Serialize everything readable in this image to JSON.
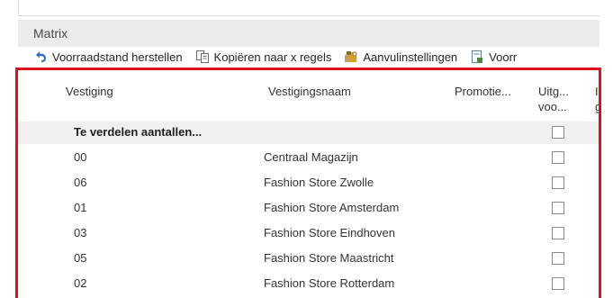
{
  "section": {
    "title": "Matrix"
  },
  "toolbar": {
    "actions": [
      {
        "label": "Voorraadstand herstellen",
        "icon": "undo-arrow-icon",
        "color": "#2f6fbf"
      },
      {
        "label": "Kopiëren naar x regels",
        "icon": "copy-document-icon",
        "color": "#6a6a6a"
      },
      {
        "label": "Aanvulinstellingen",
        "icon": "settings-boxes-icon",
        "color": "#d9a21a"
      },
      {
        "label": "Voorr",
        "icon": "document-icon",
        "color": "#5a7d9a"
      }
    ]
  },
  "table": {
    "headers": {
      "vestiging": "Vestiging",
      "vestigingsnaam": "Vestigingsnaam",
      "promotie": "Promotie...",
      "uitg_line1": "Uitg...",
      "uitg_line2": "voo...",
      "extra_line1": "I",
      "extra_line2": "g"
    },
    "group_row": {
      "label": "Te verdelen aantallen..."
    },
    "rows": [
      {
        "code": "00",
        "name": "Centraal Magazijn"
      },
      {
        "code": "06",
        "name": "Fashion Store Zwolle"
      },
      {
        "code": "01",
        "name": "Fashion Store Amsterdam"
      },
      {
        "code": "03",
        "name": "Fashion Store Eindhoven"
      },
      {
        "code": "05",
        "name": "Fashion Store Maastricht"
      },
      {
        "code": "02",
        "name": "Fashion Store Rotterdam"
      }
    ]
  },
  "colors": {
    "highlight_border": "#e0101a",
    "group_row_bg": "#f0f0f0"
  }
}
